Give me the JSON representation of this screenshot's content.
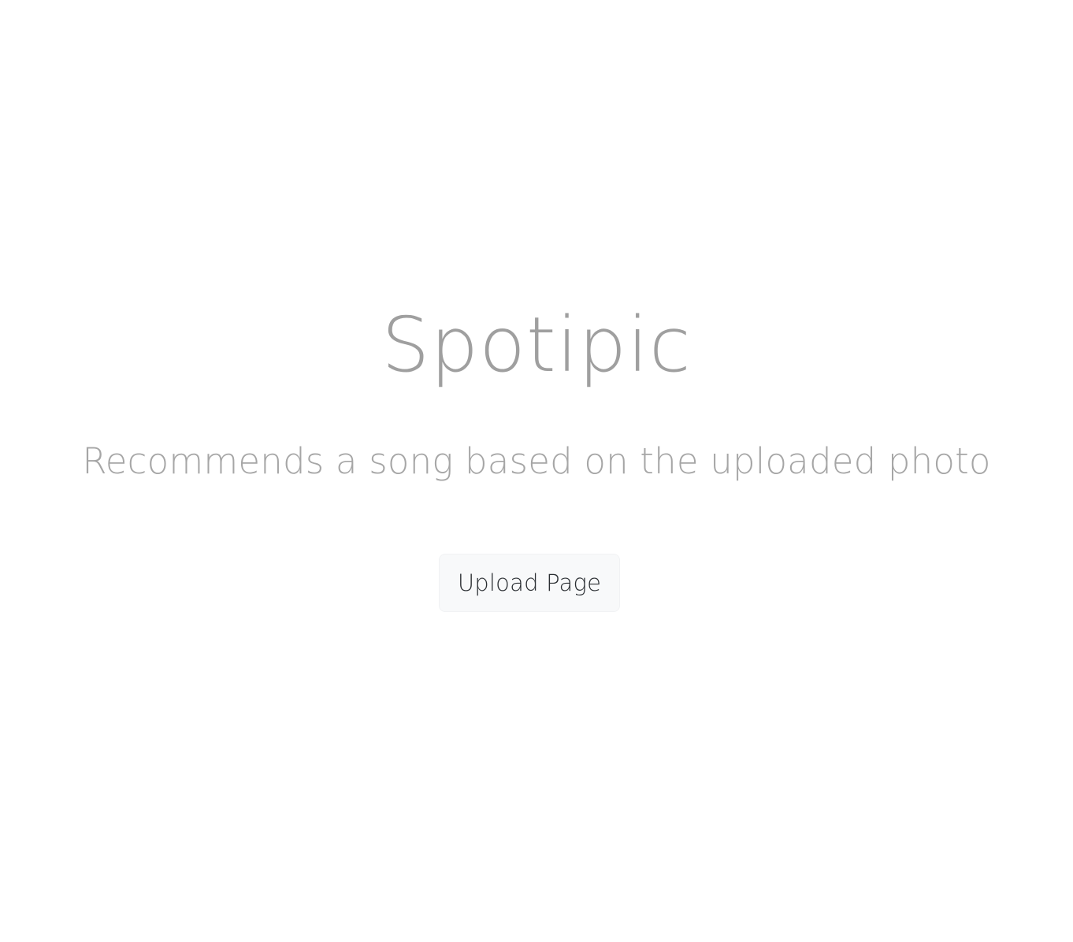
{
  "hero": {
    "title": "Spotipic",
    "subtitle": "Recommends a song based on the uploaded photo",
    "button_label": "Upload Page"
  }
}
